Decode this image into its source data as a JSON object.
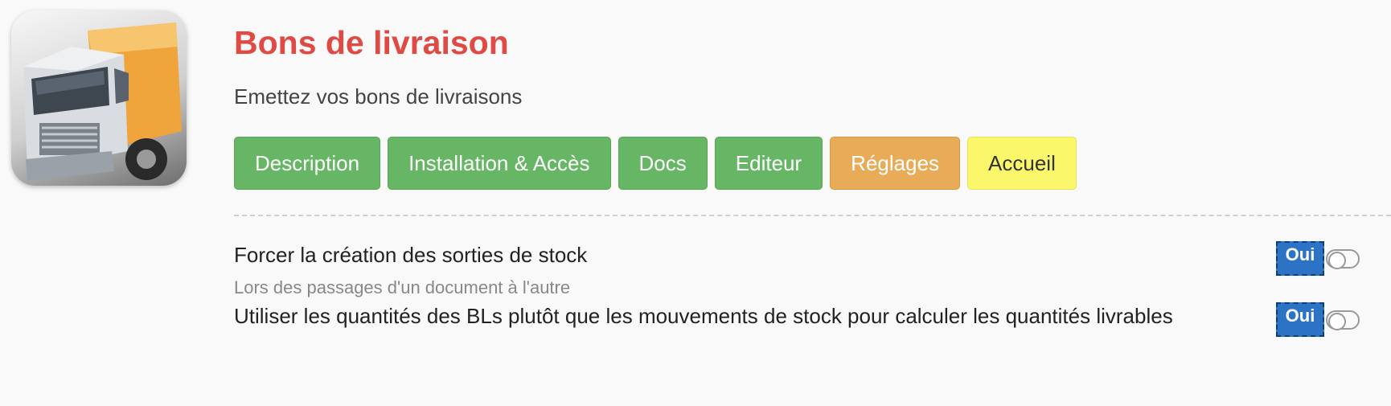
{
  "module": {
    "icon": "delivery-truck-icon",
    "title": "Bons de livraison",
    "subtitle": "Emettez vos bons de livraisons",
    "colors": {
      "title": "#e04a44",
      "tab_green": "#67b665",
      "tab_orange": "#e8ab58",
      "tab_yellow": "#fbf76a",
      "toggle_on": "#2c73c6"
    }
  },
  "tabs": [
    {
      "label": "Description",
      "style": "green"
    },
    {
      "label": "Installation & Accès",
      "style": "green"
    },
    {
      "label": "Docs",
      "style": "green"
    },
    {
      "label": "Editeur",
      "style": "green"
    },
    {
      "label": "Réglages",
      "style": "orange"
    },
    {
      "label": "Accueil",
      "style": "yellow"
    }
  ],
  "settings": [
    {
      "label": "Forcer la création des sorties de stock",
      "help": "Lors des passages d'un document à l'autre",
      "toggle_label": "Oui",
      "enabled": true
    },
    {
      "label": "Utiliser les quantités des BLs plutôt que les mouvements de stock pour calculer les quantités livrables",
      "help": "",
      "toggle_label": "Oui",
      "enabled": true
    }
  ]
}
